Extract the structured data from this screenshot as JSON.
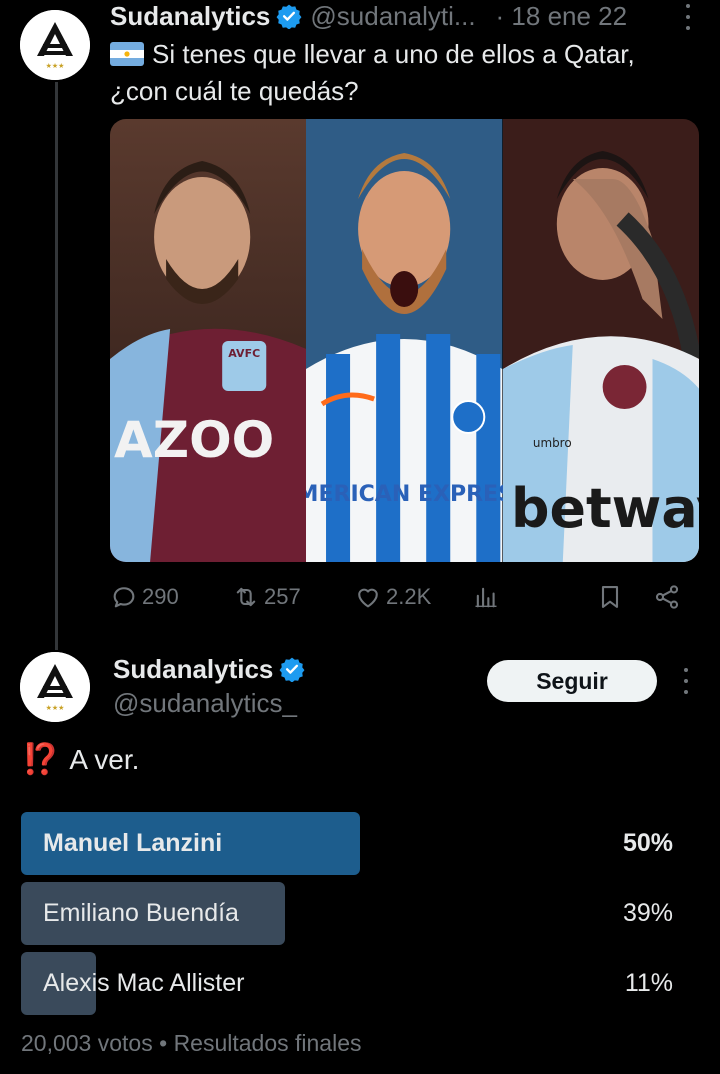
{
  "thread": {
    "parent": {
      "author_name": "Sudanalytics",
      "author_handle": "@sudanalyti...",
      "date": "· 18 ene 22",
      "text_line1": "Si tenes que llevar a uno de ellos a Qatar,",
      "text_line2": "¿con cuál te quedás?",
      "flag_icon": "argentina-flag-icon",
      "media": [
        {
          "subject": "player-claret-blue-kit",
          "sponsor_text": "AZOO",
          "crest_text": "AVFC"
        },
        {
          "subject": "player-blue-white-stripes-kit",
          "sponsor_text": "AMERICAN EXPRESS"
        },
        {
          "subject": "player-white-sky-blue-kit",
          "sponsor_text": "betway",
          "brand_text": "umbro"
        }
      ],
      "actions": {
        "replies": "290",
        "reposts": "257",
        "likes": "2.2K",
        "views": ""
      }
    },
    "reply": {
      "author_name": "Sudanalytics",
      "author_handle": "@sudanalytics_",
      "follow_label": "Seguir",
      "text": "A ver.",
      "emoji": "⁉️",
      "poll": {
        "options": [
          {
            "label": "Manuel Lanzini",
            "percent": "50%",
            "value": 50,
            "winner": true
          },
          {
            "label": "Emiliano Buendía",
            "percent": "39%",
            "value": 39,
            "winner": false
          },
          {
            "label": "Alexis Mac Allister",
            "percent": "11%",
            "value": 11,
            "winner": false
          }
        ],
        "votes": "20,003 votos",
        "separator": "•",
        "status": "Resultados finales"
      }
    }
  },
  "colors": {
    "background": "#000000",
    "text_primary": "#e7e9ea",
    "text_secondary": "#71767b",
    "verified_blue": "#1d9bf0",
    "poll_winner": "#1d5d8d",
    "poll_other": "#3a4a5b",
    "thread_line": "#333639"
  }
}
